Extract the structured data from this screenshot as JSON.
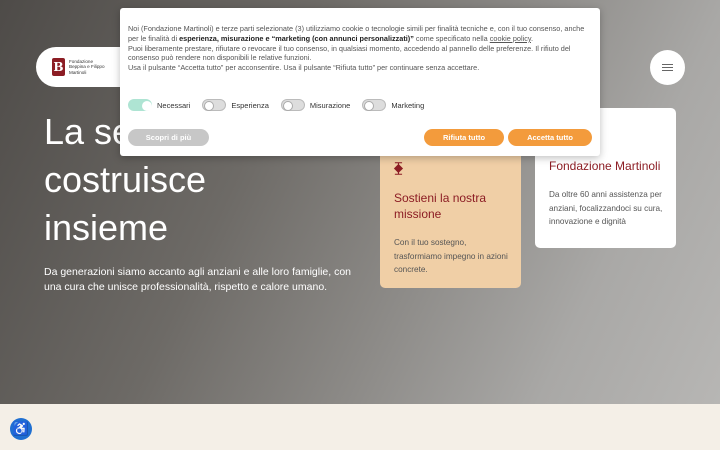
{
  "logo": {
    "mark": "B",
    "lines": [
      "Fondazione",
      "Beppina e Filippo",
      "Martinoli"
    ]
  },
  "hero": {
    "title_lines": [
      "La se",
      "costruisce",
      "insieme"
    ],
    "text": "Da generazioni siamo accanto agli anziani e alle loro famiglie, con una cura che unisce professionalità, rispetto e calore umano."
  },
  "cards": [
    {
      "icon": "ribbon-icon",
      "title": "Sostieni la nostra missione",
      "text": "Con il tuo sostegno, trasformiamo impegno in azioni concrete.",
      "bg": "#f0cfa6"
    },
    {
      "title": "Fondazione Martinoli",
      "text": "Da oltre 60 anni assistenza per anziani, focalizzandoci su cura, innovazione e dignità",
      "bg": "#ffffff"
    }
  ],
  "cookie": {
    "p1_a": "Noi (Fondazione Martinoli) e terze parti selezionate (3) utilizziamo cookie o tecnologie simili per finalità tecniche e, con il tuo consenso, anche per le finalità di ",
    "p1_b": "esperienza, misurazione e “marketing (con annunci personalizzati)”",
    "p1_c": " come specificato nella ",
    "p1_link": "cookie policy",
    "p1_d": ".",
    "p2": "Puoi liberamente prestare, rifiutare o revocare il tuo consenso, in qualsiasi momento, accedendo al pannello delle preferenze. Il rifiuto del consenso può rendere non disponibili le relative funzioni.",
    "p3": "Usa il pulsante “Accetta tutto” per acconsentire. Usa il pulsante “Rifiuta tutto” per continuare senza accettare.",
    "toggles": [
      {
        "label": "Necessari",
        "on": true
      },
      {
        "label": "Esperienza",
        "on": false
      },
      {
        "label": "Misurazione",
        "on": false
      },
      {
        "label": "Marketing",
        "on": false
      }
    ],
    "more_label": "Scopri di più",
    "reject_label": "Rifiuta tutto",
    "accept_label": "Accetta tutto",
    "accent": "#f39b3c"
  },
  "colors": {
    "brand": "#8c1d24",
    "accessibility": "#1f6fd1"
  }
}
